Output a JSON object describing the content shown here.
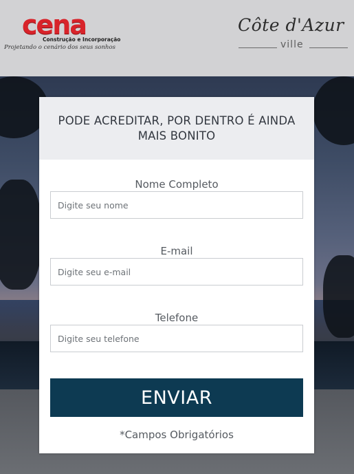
{
  "header": {
    "brand_left": {
      "name": "cena",
      "subtitle": "Construção e Incorporação",
      "tagline": "Projetando o cenário dos seus sonhos",
      "color": "#d8232a"
    },
    "brand_right": {
      "name": "Côte d'Azur",
      "subname": "ville"
    }
  },
  "form": {
    "heading": "PODE ACREDITAR, POR DENTRO É AINDA MAIS BONITO",
    "fields": [
      {
        "label": "Nome Completo",
        "placeholder": "Digite seu nome",
        "value": ""
      },
      {
        "label": "E-mail",
        "placeholder": "Digite seu e-mail",
        "value": ""
      },
      {
        "label": "Telefone",
        "placeholder": "Digite seu telefone",
        "value": ""
      }
    ],
    "submit_label": "ENVIAR",
    "required_note": "*Campos Obrigatórios",
    "submit_color": "#0d3a52"
  }
}
